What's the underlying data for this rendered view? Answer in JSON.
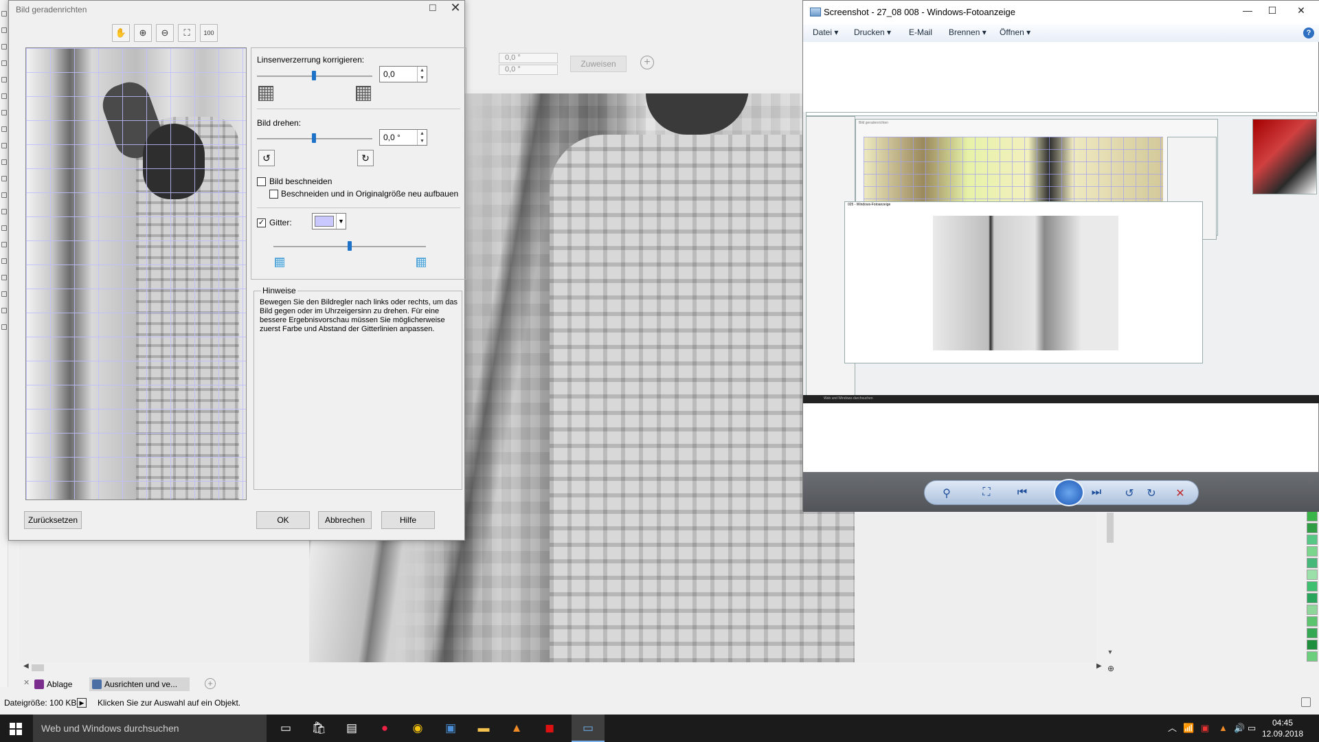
{
  "dialog": {
    "title": "Bild geradenrichten",
    "lens": {
      "label": "Linsenverzerrung korrigieren:",
      "value": "0,0"
    },
    "rotate": {
      "label": "Bild drehen:",
      "value": "0,0 °"
    },
    "crop": {
      "label": "Bild beschneiden",
      "checked": false
    },
    "crop_rebuild": {
      "label": "Beschneiden und in Originalgröße neu aufbauen",
      "checked": false
    },
    "grid": {
      "label": "Gitter:",
      "checked": true,
      "color": "#c9c9ff"
    },
    "hints": {
      "legend": "Hinweise",
      "text": "Bewegen Sie den Bildregler nach links oder rechts, um das Bild gegen oder im Uhrzeigersinn zu drehen. Für eine bessere Ergebnisvorschau müssen Sie möglicherweise zuerst Farbe und Abstand der Gitterlinien anpassen."
    },
    "buttons": {
      "reset": "Zurücksetzen",
      "ok": "OK",
      "cancel": "Abbrechen",
      "help": "Hilfe"
    },
    "tools": [
      "hand-icon",
      "zoom-in-icon",
      "zoom-out-icon",
      "fit-to-window-icon",
      "actual-size-icon"
    ],
    "actual_size_label": "100"
  },
  "property_bar": {
    "field1": "0,0 °",
    "field2": "0,0 °",
    "assign": "Zuweisen"
  },
  "viewer": {
    "title": "Screenshot - 27_08 008 - Windows-Fotoanzeige",
    "menu": [
      "Datei",
      "Drucken",
      "E-Mail",
      "Brennen",
      "Öffnen"
    ],
    "nested_title": "Bild geradenrichten",
    "nested_viewer_title": "025 - Windows-Fotoanzeige",
    "nested_search": "Web und Windows durchsuchen"
  },
  "doc_tabs": [
    "Ablage",
    "Ausrichten und ve..."
  ],
  "status": {
    "filesize": "Dateigröße: 100 KB",
    "hint": "Klicken Sie zur Auswahl auf ein Objekt."
  },
  "taskbar": {
    "search_placeholder": "Web und Windows durchsuchen",
    "time": "04:45",
    "date": "12.09.2018"
  },
  "palette_colors": [
    "#39b54a",
    "#2f9e44",
    "#57c785",
    "#7ad68c",
    "#46b97a",
    "#9be0a8",
    "#3ec070",
    "#2aa55c",
    "#8fd69a",
    "#5cc46e",
    "#34a853",
    "#1f8e3d",
    "#6ccf7e"
  ]
}
